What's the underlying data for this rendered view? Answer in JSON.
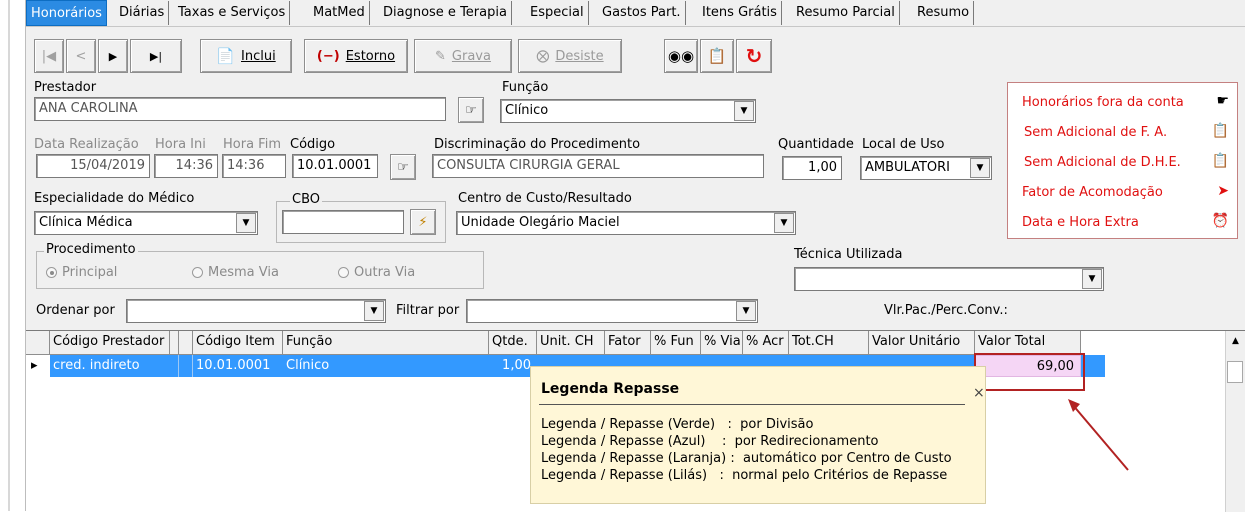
{
  "tabs": [
    "Honorários",
    "Diárias",
    "Taxas e Serviços",
    "MatMed",
    "Diagnose e Terapia",
    "Especial",
    "Gastos Part.",
    "Itens Grátis",
    "Resumo Parcial",
    "Resumo"
  ],
  "toolbar": {
    "inclui": "Inclui",
    "estorno": "Estorno",
    "grava": "Grava",
    "desiste": "Desiste"
  },
  "form": {
    "prestador_label": "Prestador",
    "prestador_value": "ANA CAROLINA",
    "funcao_label": "Função",
    "funcao_value": "Clínico",
    "data_label": "Data Realização",
    "data_value": "15/04/2019",
    "hora_ini_label": "Hora Ini",
    "hora_ini_value": "14:36",
    "hora_fim_label": "Hora Fim",
    "hora_fim_value": "14:36",
    "codigo_label": "Código",
    "codigo_value": "10.01.0001",
    "discriminacao_label": "Discriminação do Procedimento",
    "discriminacao_value": "CONSULTA CIRURGIA GERAL",
    "quantidade_label": "Quantidade",
    "quantidade_value": "1,00",
    "local_label": "Local de Uso",
    "local_value": "AMBULATORI",
    "especialidade_label": "Especialidade do Médico",
    "especialidade_value": "Clínica Médica",
    "cbo_label": "CBO",
    "centro_label": "Centro de Custo/Resultado",
    "centro_value": "Unidade Olegário Maciel",
    "procedimento_label": "Procedimento",
    "radio_principal": "Principal",
    "radio_mesma": "Mesma Via",
    "radio_outra": "Outra Via",
    "tecnica_label": "Técnica Utilizada",
    "ordenar_label": "Ordenar por",
    "filtrar_label": "Filtrar por",
    "vlr_label": "Vlr.Pac./Perc.Conv.:"
  },
  "legend": {
    "items": [
      "Honorários fora da conta",
      "Sem Adicional de F. A.",
      "Sem Adicional de D.H.E.",
      "Fator de Acomodação",
      "Data e Hora Extra"
    ]
  },
  "grid": {
    "headers": [
      "Código Prestador",
      "",
      "",
      "Código Item",
      "Função",
      "Qtde.",
      "Unit. CH",
      "Fator",
      "% Fun",
      "% Via",
      "% Acr",
      "Tot.CH",
      "Valor Unitário",
      "Valor Total"
    ],
    "row": {
      "prestador": "cred. indireto",
      "codigo_item": "10.01.0001",
      "funcao": "Clínico",
      "qtde": "1,00",
      "valor_total": "69,00"
    }
  },
  "tooltip": {
    "title": "Legenda Repasse",
    "lines": [
      "Legenda / Repasse (Verde)   :  por Divisão",
      "Legenda / Repasse (Azul)    :  por Redirecionamento",
      "Legenda / Repasse (Laranja) :  automático por Centro de Custo",
      "Legenda / Repasse (Lilás)   :  normal pelo Critérios de Repasse"
    ]
  },
  "colors": {
    "selection": "#3399ff",
    "legend_text": "#e01010",
    "tooltip_bg": "#fff7d7",
    "valor_total_bg": "#f5d6f5",
    "annotation": "#b22222"
  }
}
